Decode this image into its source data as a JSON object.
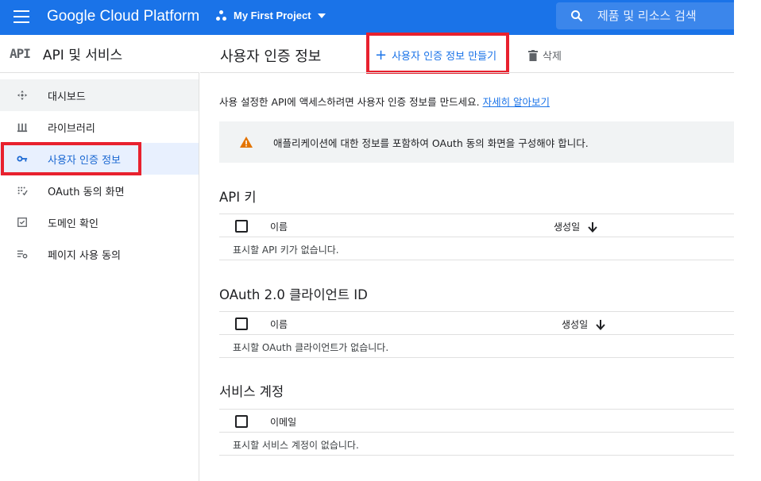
{
  "topbar": {
    "brand": "Google Cloud Platform",
    "project": "My First Project",
    "search_placeholder": "제품 및 리소스 검색",
    "color": "#1a73e8"
  },
  "sidebar": {
    "logo": "API",
    "title": "API 및 서비스",
    "items": [
      {
        "label": "대시보드",
        "icon": "dashboard-icon"
      },
      {
        "label": "라이브러리",
        "icon": "library-icon"
      },
      {
        "label": "사용자 인증 정보",
        "icon": "key-icon",
        "active": true
      },
      {
        "label": "OAuth 동의 화면",
        "icon": "oauth-consent-icon"
      },
      {
        "label": "도메인 확인",
        "icon": "checkbox-icon"
      },
      {
        "label": "페이지 사용 동의",
        "icon": "settings-list-icon"
      }
    ]
  },
  "header": {
    "title": "사용자 인증 정보",
    "create_label": "사용자 인증 정보 만들기",
    "delete_label": "삭제"
  },
  "intro": {
    "text": "사용 설정한 API에 액세스하려면 사용자 인증 정보를 만드세요.",
    "link": "자세히 알아보기"
  },
  "alert": {
    "text": "애플리케이션에 대한 정보를 포함하여 OAuth 동의 화면을 구성해야 합니다.",
    "icon": "warning-icon"
  },
  "sections": {
    "api_keys": {
      "title": "API 키",
      "col_name": "이름",
      "col_date": "생성일",
      "empty": "표시할 API 키가 없습니다."
    },
    "oauth": {
      "title": "OAuth 2.0 클라이언트 ID",
      "col_name": "이름",
      "col_date": "생성일",
      "empty": "표시할 OAuth 클라이언트가 없습니다."
    },
    "service": {
      "title": "서비스 계정",
      "col_email": "이메일",
      "empty": "표시할 서비스 계정이 없습니다."
    }
  },
  "highlight_color": "#e8212e"
}
